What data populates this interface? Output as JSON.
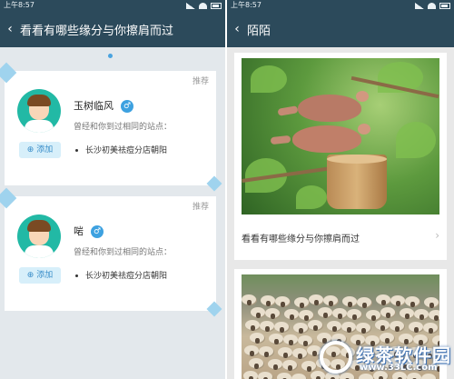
{
  "left": {
    "status_time": "上午8:57",
    "title": "看看有哪些缘分与你擦肩而过",
    "back_icon": "‹",
    "users": [
      {
        "tag": "推荐",
        "name": "玉树临风",
        "gender_symbol": "♂",
        "desc": "曾经和你到过相同的站点：",
        "place": "长沙初美祛痘分店朝阳",
        "add_label": "添加"
      },
      {
        "tag": "推荐",
        "name": "啱",
        "gender_symbol": "♂",
        "desc": "曾经和你到过相同的站点：",
        "place": "长沙初美祛痘分店朝阳",
        "add_label": "添加"
      }
    ]
  },
  "right": {
    "status_time": "上午8:57",
    "title": "陌陌",
    "back_icon": "‹",
    "feed_title": "看看有哪些缘分与你擦肩而过",
    "chevron": "›"
  },
  "watermark": {
    "text": "绿茶软件园",
    "url": "www.33LC.com"
  },
  "colors": {
    "titlebar": "#2c4a5b",
    "accent": "#3da1e0",
    "avatar_bg": "#22b9a5"
  }
}
